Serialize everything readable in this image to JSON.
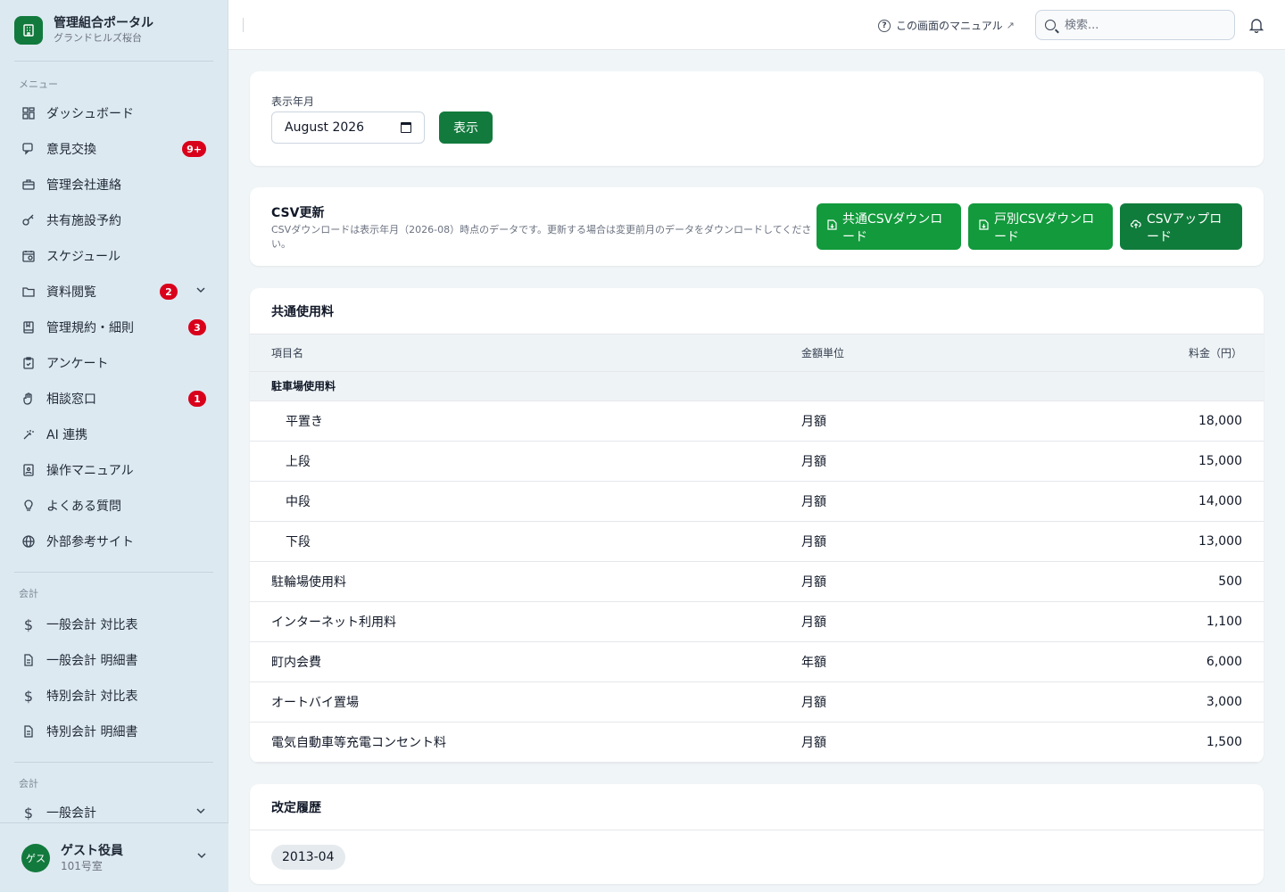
{
  "app": {
    "title": "管理組合ポータル",
    "subtitle": "グランドヒルズ桜台"
  },
  "sidebar": {
    "menu_label": "メニュー",
    "items": [
      {
        "label": "ダッシュボード",
        "icon": "dashboard-icon"
      },
      {
        "label": "意見交換",
        "icon": "chat-icon",
        "badge": "9+"
      },
      {
        "label": "管理会社連絡",
        "icon": "briefcase-icon"
      },
      {
        "label": "共有施設予約",
        "icon": "key-icon"
      },
      {
        "label": "スケジュール",
        "icon": "calendar-icon"
      },
      {
        "label": "資料閲覧",
        "icon": "folder-icon",
        "badge": "2"
      },
      {
        "label": "管理規約・細則",
        "icon": "book-icon",
        "badge": "3"
      },
      {
        "label": "アンケート",
        "icon": "clipboard-icon"
      },
      {
        "label": "相談窓口",
        "icon": "hand-icon",
        "badge": "1"
      },
      {
        "label": "AI 連携",
        "icon": "sparkle-icon"
      },
      {
        "label": "操作マニュアル",
        "icon": "manual-icon"
      },
      {
        "label": "よくある質問",
        "icon": "lightbulb-icon"
      },
      {
        "label": "外部参考サイト",
        "icon": "globe-icon"
      }
    ],
    "accounting_label": "会計",
    "accounting_items": [
      {
        "label": "一般会計 対比表",
        "icon": "dollar-icon"
      },
      {
        "label": "一般会計 明細書",
        "icon": "document-icon"
      },
      {
        "label": "特別会計 対比表",
        "icon": "dollar-icon"
      },
      {
        "label": "特別会計 明細書",
        "icon": "document-icon"
      }
    ],
    "accounting2_label": "会計",
    "accounting2_items": [
      {
        "label": "一般会計",
        "icon": "dollar-icon"
      }
    ]
  },
  "user": {
    "avatar": "ゲス",
    "name": "ゲスト役員",
    "room": "101号室"
  },
  "header": {
    "manual_link": "この画面のマニュアル",
    "search_placeholder": "検索..."
  },
  "filter": {
    "label": "表示年月",
    "month_value": "August 2026",
    "show_button": "表示"
  },
  "csv": {
    "title": "CSV更新",
    "description": "CSVダウンロードは表示年月（2026-08）時点のデータです。更新する場合は変更前月のデータをダウンロードしてください。",
    "common_download": "共通CSVダウンロード",
    "unit_download": "戸別CSVダウンロード",
    "upload": "CSVアップロード"
  },
  "fees": {
    "title": "共通使用料",
    "columns": [
      "項目名",
      "金額単位",
      "料金（円）"
    ],
    "group": "駐車場使用料",
    "sub_rows": [
      {
        "name": "平置き",
        "unit": "月額",
        "price": "18,000"
      },
      {
        "name": "上段",
        "unit": "月額",
        "price": "15,000"
      },
      {
        "name": "中段",
        "unit": "月額",
        "price": "14,000"
      },
      {
        "name": "下段",
        "unit": "月額",
        "price": "13,000"
      }
    ],
    "rows": [
      {
        "name": "駐輪場使用料",
        "unit": "月額",
        "price": "500"
      },
      {
        "name": "インターネット利用料",
        "unit": "月額",
        "price": "1,100"
      },
      {
        "name": "町内会費",
        "unit": "年額",
        "price": "6,000"
      },
      {
        "name": "オートバイ置場",
        "unit": "月額",
        "price": "3,000"
      },
      {
        "name": "電気自動車等充電コンセント料",
        "unit": "月額",
        "price": "1,500"
      }
    ]
  },
  "history": {
    "title": "改定履歴",
    "tags": [
      "2013-04"
    ]
  },
  "colors": {
    "brand": "#127a3d",
    "button_green": "#129a3c",
    "badge_red": "#d9001b",
    "sidebar_bg": "#dde9f1"
  }
}
